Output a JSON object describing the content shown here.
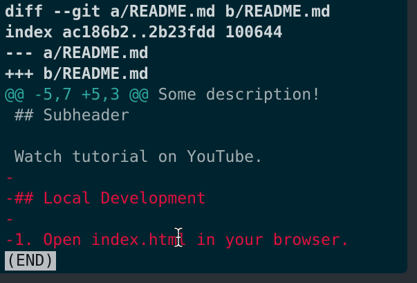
{
  "terminal": {
    "lines": [
      {
        "text": "diff --git a/README.md b/README.md"
      },
      {
        "text": "index ac186b2..2b23fdd 100644"
      },
      {
        "text": "--- a/README.md"
      },
      {
        "text": "+++ b/README.md"
      },
      {
        "hunk": "@@ -5,7 +5,3 @@",
        "text": " Some description!"
      },
      {
        "text": " ## Subheader"
      },
      {
        "text": ""
      },
      {
        "text": " Watch tutorial on YouTube."
      },
      {
        "text": "-"
      },
      {
        "text": "-## Local Development"
      },
      {
        "text": "-"
      },
      {
        "text": "-1. Open index.html in your browser."
      }
    ],
    "pager_status": "(END)"
  },
  "colors": {
    "background": "#00242f",
    "removed": "#e0103e",
    "hunk": "#2fa8a0",
    "header": "#cfd6d9",
    "context": "#a3aeb2"
  },
  "icons": {
    "cursor": "text-cursor-icon"
  }
}
